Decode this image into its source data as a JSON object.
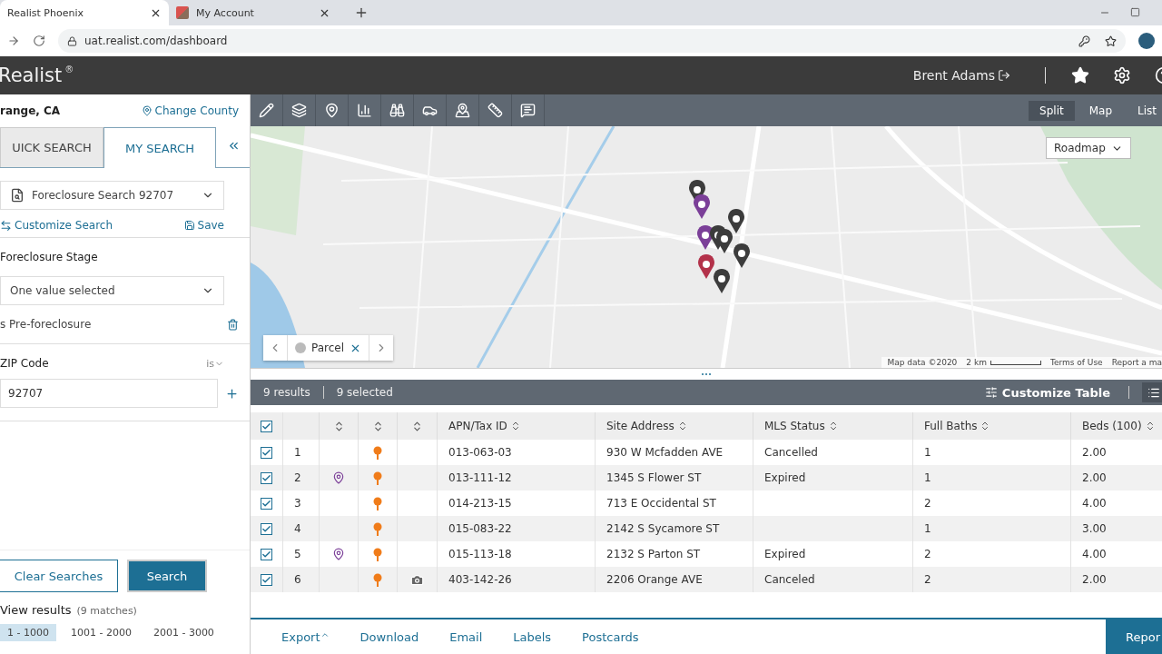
{
  "browser": {
    "tabs": [
      {
        "title": "Realist Phoenix",
        "selected": true
      },
      {
        "title": "My Account",
        "selected": false
      }
    ],
    "url": "uat.realist.com/dashboard"
  },
  "header": {
    "logo": "Realist",
    "logo_mark": "®",
    "user": "Brent Adams"
  },
  "sidebar": {
    "county": "range, CA",
    "change_county": "Change County",
    "tabs": [
      {
        "label": "UICK SEARCH",
        "selected": false
      },
      {
        "label": "MY SEARCH",
        "selected": true
      }
    ],
    "saved_search": "Foreclosure Search 92707",
    "customize": "Customize Search",
    "save": "Save",
    "filters": [
      {
        "kind": "select",
        "label": "Foreclosure Stage",
        "value": "One value selected",
        "chip": "s Pre-foreclosure"
      },
      {
        "kind": "input",
        "label": "ZIP Code",
        "operator": "is",
        "value": "92707"
      }
    ],
    "clear_button": "Clear Searches",
    "search_button": "Search",
    "view_results": "View results",
    "matches": "(9 matches)",
    "pages": [
      {
        "label": "1 - 1000",
        "selected": true
      },
      {
        "label": "1001 - 2000",
        "selected": false
      },
      {
        "label": "2001 - 3000",
        "selected": false
      }
    ]
  },
  "views": [
    {
      "label": "Split",
      "selected": true
    },
    {
      "label": "Map",
      "selected": false
    },
    {
      "label": "List",
      "selected": false
    }
  ],
  "map": {
    "kind": "picture",
    "map_type": "Roadmap",
    "layer": "Parcel",
    "attribution": "Map data ©2020",
    "scale": "2 km",
    "terms": "Terms of Use",
    "report": "Report a ma"
  },
  "results": {
    "count": "9 results",
    "selected": "9 selected",
    "customize": "Customize Table"
  },
  "table": {
    "all_checked": true,
    "columns": [
      {
        "kind": "index"
      },
      {
        "kind": "sort"
      },
      {
        "kind": "sort"
      },
      {
        "kind": "sort"
      },
      {
        "kind": "text",
        "label": "APN/Tax ID"
      },
      {
        "kind": "text",
        "label": "Site Address"
      },
      {
        "kind": "text",
        "label": "MLS Status"
      },
      {
        "kind": "text",
        "label": "Full Baths"
      },
      {
        "kind": "text",
        "label": "Beds (100)"
      }
    ],
    "rows": [
      {
        "checked": true,
        "number": "1",
        "listing_pin": false,
        "foreclosure_pin": true,
        "photo": false,
        "apn": "013-063-03",
        "address": "930 W Mcfadden AVE",
        "mls_status": "Cancelled",
        "full_baths": "1",
        "beds": "2.00"
      },
      {
        "checked": true,
        "number": "2",
        "listing_pin": true,
        "foreclosure_pin": true,
        "photo": false,
        "apn": "013-111-12",
        "address": "1345 S Flower ST",
        "mls_status": "Expired",
        "full_baths": "1",
        "beds": "2.00"
      },
      {
        "checked": true,
        "number": "3",
        "listing_pin": false,
        "foreclosure_pin": true,
        "photo": false,
        "apn": "014-213-15",
        "address": "713 E Occidental ST",
        "full_baths": "2",
        "beds": "4.00"
      },
      {
        "checked": true,
        "number": "4",
        "listing_pin": false,
        "foreclosure_pin": true,
        "photo": false,
        "apn": "015-083-22",
        "address": "2142 S Sycamore ST",
        "full_baths": "1",
        "beds": "3.00"
      },
      {
        "checked": true,
        "number": "5",
        "listing_pin": true,
        "foreclosure_pin": true,
        "photo": false,
        "apn": "015-113-18",
        "address": "2132 S Parton ST",
        "mls_status": "Expired",
        "full_baths": "2",
        "beds": "4.00"
      },
      {
        "checked": true,
        "number": "6",
        "listing_pin": false,
        "foreclosure_pin": true,
        "photo": true,
        "apn": "403-142-26",
        "address": "2206 Orange AVE",
        "mls_status": "Canceled",
        "full_baths": "2",
        "beds": "2.00"
      }
    ]
  },
  "footer": {
    "actions": [
      {
        "label": "Export",
        "caret": true
      },
      {
        "label": "Download",
        "caret": false
      },
      {
        "label": "Email",
        "caret": false
      },
      {
        "label": "Labels",
        "caret": false
      },
      {
        "label": "Postcards",
        "caret": false
      }
    ],
    "report": "Repor"
  }
}
